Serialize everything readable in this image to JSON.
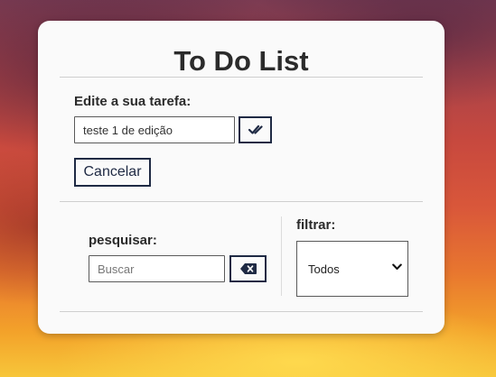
{
  "app": {
    "title": "To Do List"
  },
  "edit": {
    "label": "Edite a sua tarefa:",
    "input_value": "teste 1 de edição",
    "confirm_icon": "double-check-icon",
    "cancel_label": "Cancelar"
  },
  "search": {
    "label": "pesquisar:",
    "placeholder": "Buscar",
    "clear_icon": "backspace-icon"
  },
  "filter": {
    "label": "filtrar:",
    "selected": "Todos",
    "dropdown_icon": "chevron-down-icon"
  },
  "colors": {
    "accent": "#1f2a44",
    "card_bg": "#fafafa",
    "title_text": "#2b2b2b"
  }
}
